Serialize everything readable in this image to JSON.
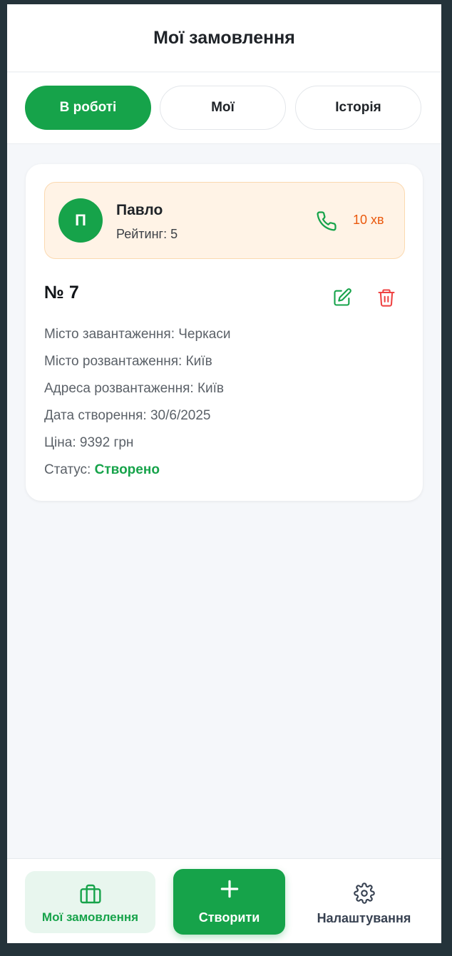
{
  "header": {
    "title": "Мої замовлення"
  },
  "tabs": [
    {
      "label": "В роботі",
      "active": true
    },
    {
      "label": "Мої",
      "active": false
    },
    {
      "label": "Історія",
      "active": false
    }
  ],
  "order": {
    "driver": {
      "initial": "П",
      "name": "Павло",
      "rating": "Рейтинг: 5",
      "eta": "10 хв"
    },
    "number": "№ 7",
    "details": {
      "loading_city": "Місто завантаження: Черкаси",
      "unloading_city": "Місто розвантаження: Київ",
      "unloading_address": "Адреса розвантаження: Київ",
      "created_date": "Дата створення: 30/6/2025",
      "price": "Ціна: 9392 грн",
      "status_label": "Статус: ",
      "status_value": "Створено"
    }
  },
  "bottom_nav": {
    "mine": "Мої замовлення",
    "create": "Створити",
    "settings": "Налаштування"
  },
  "icons": {
    "phone": "phone-icon",
    "edit": "edit-icon",
    "delete": "trash-icon",
    "mine": "briefcase-icon",
    "create": "plus-icon",
    "settings": "gear-icon"
  },
  "colors": {
    "accent": "#16a34a",
    "eta": "#ea580c",
    "delete": "#ef4444",
    "driver_bg": "#fff3e6"
  }
}
